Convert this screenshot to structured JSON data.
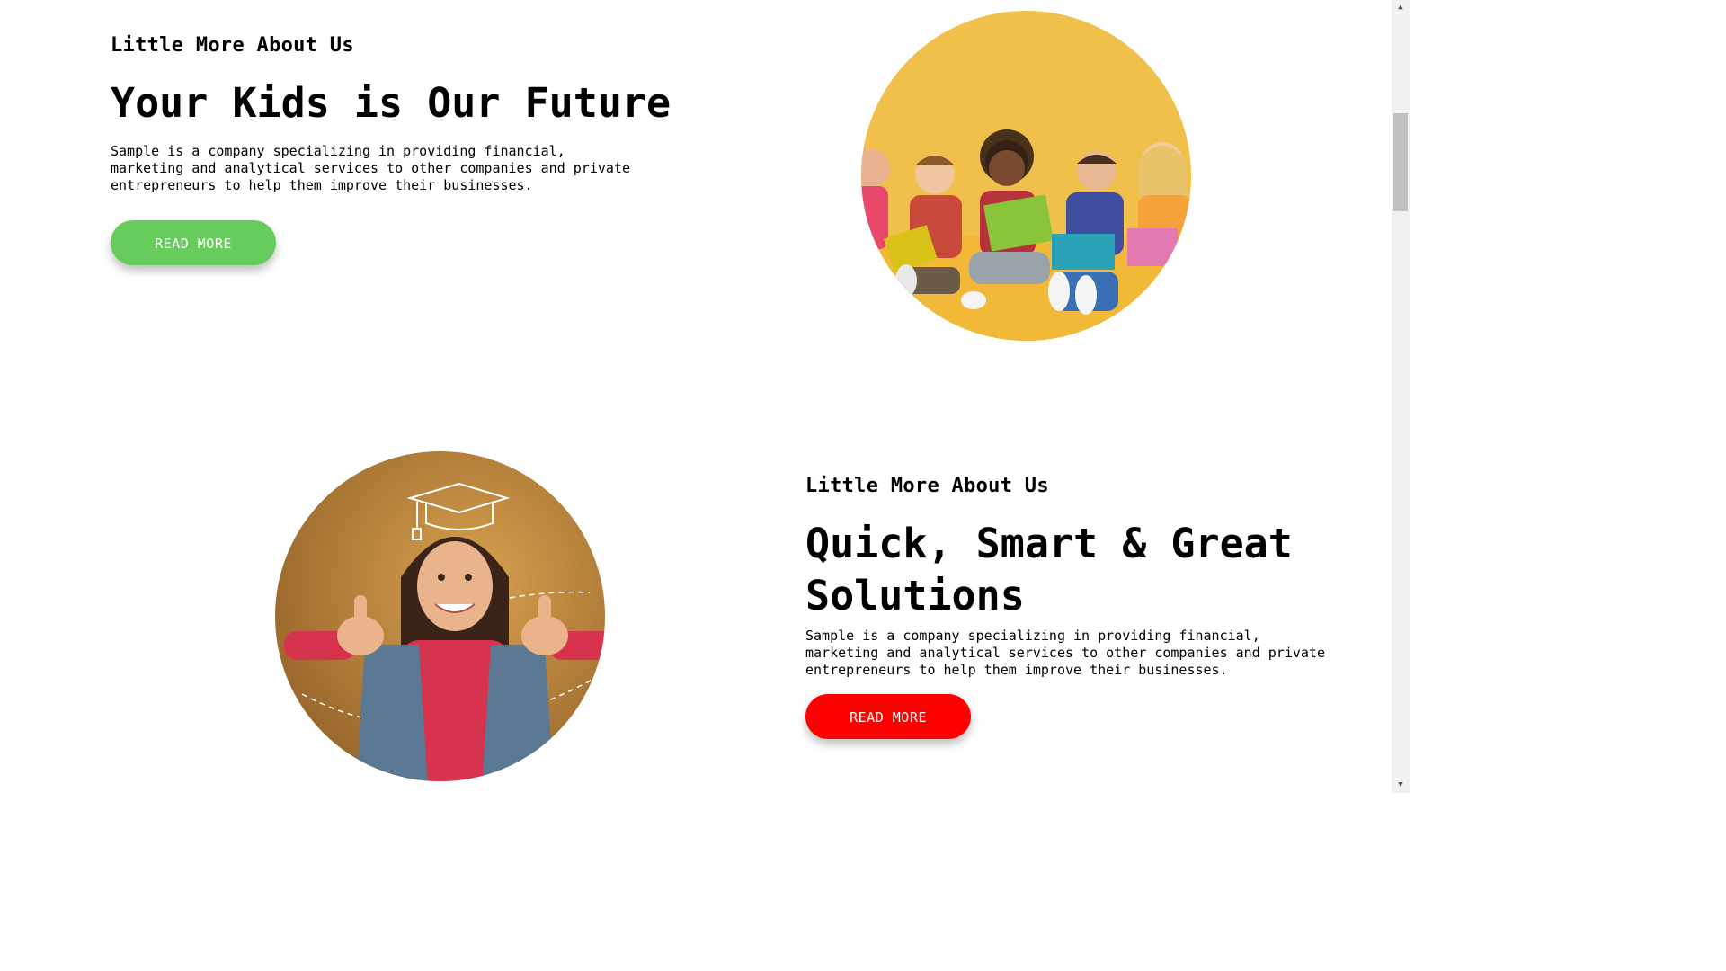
{
  "section1": {
    "eyebrow": "Little More About Us",
    "heading": "Your Kids is Our Future",
    "body": "Sample is a company specializing in providing financial, marketing and analytical services to other companies and private entrepreneurs to help them improve their businesses.",
    "button_label": "READ MORE",
    "button_color": "#66cc5c",
    "image_bg": "#f0c04a"
  },
  "section2": {
    "eyebrow": "Little More About Us",
    "heading_line1": "Quick, Smart & Great",
    "heading_line2": "Solutions",
    "body": "Sample is a company specializing in providing financial, marketing and analytical services to other companies and private entrepreneurs to help them improve their businesses.",
    "button_label": "READ MORE",
    "button_color": "#ff0000",
    "image_bg": "#b37a34"
  },
  "scrollbar": {
    "up_icon": "▲",
    "down_icon": "▼"
  }
}
